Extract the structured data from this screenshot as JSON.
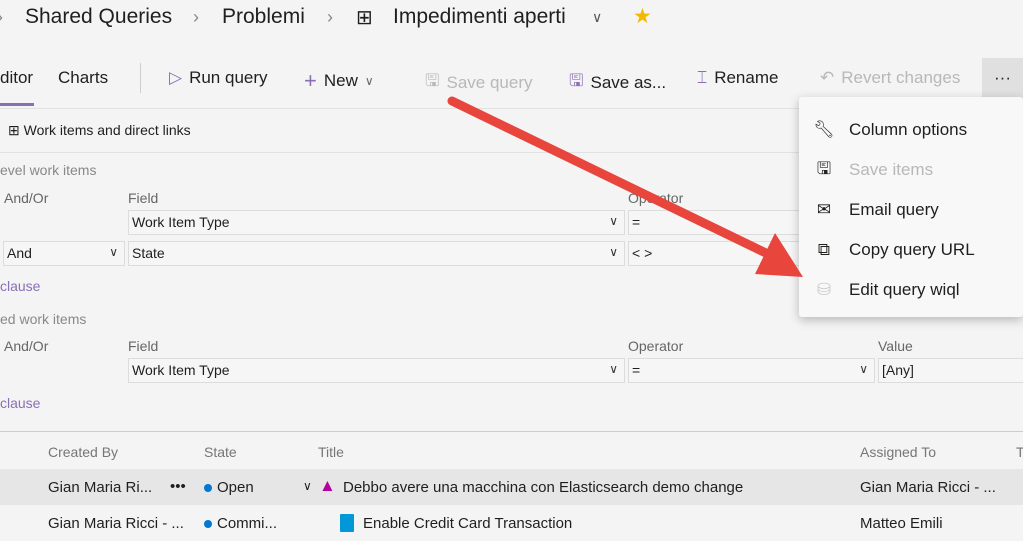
{
  "breadcrumb": {
    "items": [
      "Shared Queries",
      "Problemi",
      "Impedimenti aperti"
    ],
    "favorite_color": "#f5b800"
  },
  "tabs": [
    {
      "label": "ditor",
      "active": true
    },
    {
      "label": "Charts"
    }
  ],
  "toolbar": {
    "run": "Run query",
    "new": "New",
    "save": "Save query",
    "save_as": "Save as...",
    "rename": "Rename",
    "revert": "Revert changes",
    "more": "···"
  },
  "query_type": "Work items and direct links",
  "section1": {
    "title": "evel work items",
    "headers": [
      "And/Or",
      "Field",
      "Operator"
    ],
    "rows": [
      {
        "andor": "",
        "field": "Work Item Type",
        "operator": "="
      },
      {
        "andor": "And",
        "field": "State",
        "operator": "< >"
      }
    ],
    "add_clause": "clause"
  },
  "section2": {
    "title": "ed work items",
    "headers": [
      "And/Or",
      "Field",
      "Operator",
      "Value"
    ],
    "rows": [
      {
        "field": "Work Item Type",
        "operator": "=",
        "value": "[Any]"
      }
    ],
    "add_clause": "clause"
  },
  "menu": {
    "items": [
      {
        "label": "Column options",
        "icon": "wrench-icon",
        "disabled": false
      },
      {
        "label": "Save items",
        "icon": "save-items-icon",
        "disabled": true
      },
      {
        "label": "Email query",
        "icon": "mail-icon",
        "disabled": false
      },
      {
        "label": "Copy query URL",
        "icon": "copy-icon",
        "disabled": false
      },
      {
        "label": "Edit query wiql",
        "icon": "edit-wiql-icon",
        "disabled": false
      }
    ]
  },
  "grid": {
    "headers": [
      "Created By",
      "State",
      "Title",
      "Assigned To",
      "T"
    ],
    "rows": [
      {
        "created_by": "Gian Maria Ri...",
        "more": "•••",
        "state": "Open",
        "title": "Debbo avere una macchina con Elasticsearch demo change",
        "assigned_to": "Gian Maria Ricci - ..."
      },
      {
        "created_by": "Gian Maria Ricci - ...",
        "state": "Commi...",
        "title": "Enable Credit Card Transaction",
        "assigned_to": "Matteo Emili"
      }
    ]
  },
  "annotation_color": "#e8453c"
}
